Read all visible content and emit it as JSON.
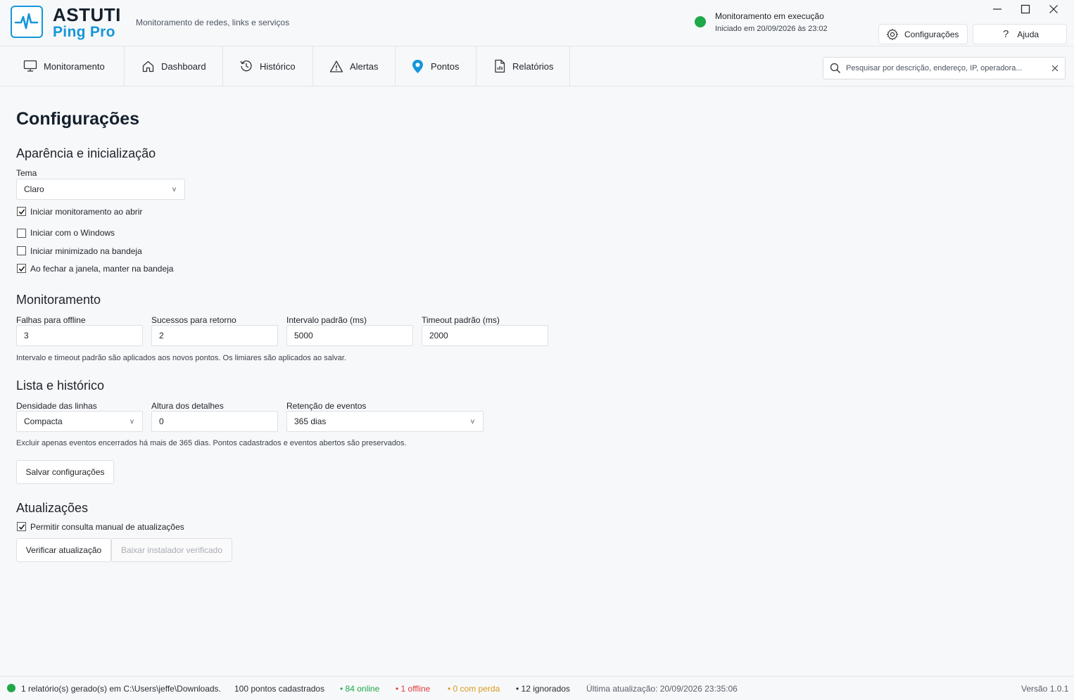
{
  "app": {
    "brand_line1": "ASTUTI",
    "brand_line2": "Ping Pro",
    "tagline": "Monitoramento de redes, links e serviços",
    "status_title": "Monitoramento em execução",
    "status_subtitle": "Iniciado em 20/09/2026 às 23:02",
    "settings_button": "Configurações",
    "help_button": "Ajuda",
    "accent_color": "#1696d9",
    "status_color": "#1fa84a"
  },
  "tabs": [
    {
      "label": "Monitoramento",
      "icon": "monitor-icon"
    },
    {
      "label": "Dashboard",
      "icon": "home-icon"
    },
    {
      "label": "Histórico",
      "icon": "history-icon"
    },
    {
      "label": "Alertas",
      "icon": "warning-icon"
    },
    {
      "label": "Pontos",
      "icon": "location-pin-icon"
    },
    {
      "label": "Relatórios",
      "icon": "report-icon"
    }
  ],
  "search": {
    "placeholder": "Pesquisar por descrição, endereço, IP, operadora..."
  },
  "page": {
    "title": "Configurações",
    "appearance": {
      "heading": "Aparência e inicialização",
      "theme_label": "Tema",
      "theme_value": "Claro",
      "checkboxes": [
        {
          "label": "Iniciar monitoramento ao abrir",
          "checked": true
        },
        {
          "label": "Iniciar com o Windows",
          "checked": false
        },
        {
          "label": "Iniciar minimizado na bandeja",
          "checked": false
        },
        {
          "label": "Ao fechar a janela, manter na bandeja",
          "checked": true
        }
      ]
    },
    "monitoring": {
      "heading": "Monitoramento",
      "fields": [
        {
          "label": "Falhas para offline",
          "value": "3"
        },
        {
          "label": "Sucessos para retorno",
          "value": "2"
        },
        {
          "label": "Intervalo padrão (ms)",
          "value": "5000"
        },
        {
          "label": "Timeout padrão (ms)",
          "value": "2000"
        }
      ],
      "hint": "Intervalo e timeout padrão são aplicados aos novos pontos. Os limiares são aplicados ao salvar."
    },
    "list_history": {
      "heading": "Lista e histórico",
      "density_label": "Densidade das linhas",
      "density_value": "Compacta",
      "details_height_label": "Altura dos detalhes",
      "details_height_value": "0",
      "retention_label": "Retenção de eventos",
      "retention_value": "365 dias",
      "hint": "Excluir apenas eventos encerrados há mais de 365 dias. Pontos cadastrados e eventos abertos são preservados.",
      "save_button": "Salvar configurações"
    },
    "updates": {
      "heading": "Atualizações",
      "allow_manual_label": "Permitir consulta manual de atualizações",
      "allow_manual_checked": true,
      "check_button": "Verificar atualização",
      "download_button": "Baixar instalador verificado"
    }
  },
  "statusbar": {
    "report_msg": "1 relatório(s) gerado(s) em C:\\Users\\jeffe\\Downloads.",
    "total_points": "100 pontos cadastrados",
    "online": "• 84 online",
    "offline": "• 1 offline",
    "loss": "• 0 com perda",
    "ignored": "• 12 ignorados",
    "last_update": "Última atualização: 20/09/2026 23:35:06",
    "version": "Versão 1.0.1",
    "online_color": "#1fa84a",
    "offline_color": "#e03b3b",
    "loss_color": "#d99a1a"
  }
}
